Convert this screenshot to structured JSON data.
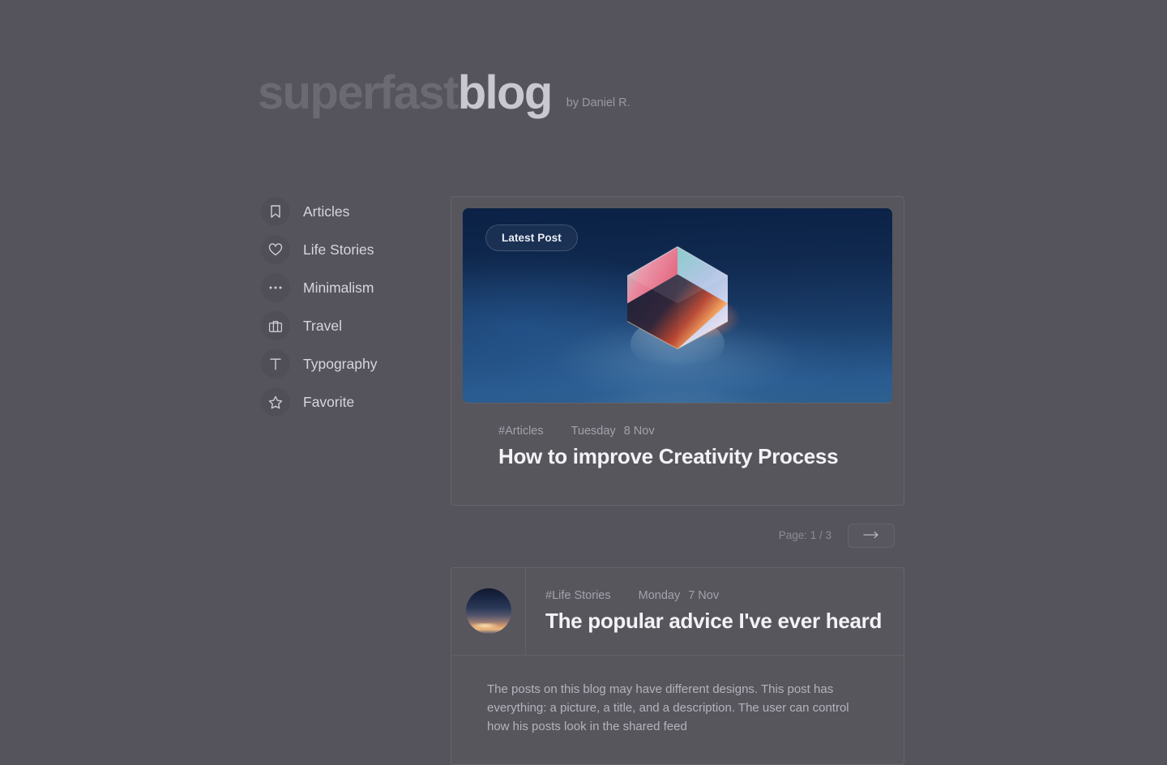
{
  "header": {
    "logo_part_a": "superfast",
    "logo_part_b": "blog",
    "byline": "by Daniel R."
  },
  "sidebar": {
    "items": [
      {
        "label": "Articles",
        "icon": "bookmark-icon"
      },
      {
        "label": "Life Stories",
        "icon": "heart-icon"
      },
      {
        "label": "Minimalism",
        "icon": "ellipsis-icon"
      },
      {
        "label": "Travel",
        "icon": "briefcase-icon"
      },
      {
        "label": "Typography",
        "icon": "text-t-icon"
      },
      {
        "label": "Favorite",
        "icon": "star-icon"
      }
    ]
  },
  "featured_post": {
    "badge": "Latest Post",
    "tag": "#Articles",
    "day": "Tuesday",
    "date": "8 Nov",
    "title": "How to improve Creativity Process",
    "image_alt": "iridescent-glass-cube"
  },
  "pagination": {
    "page_label": "Page: 1 / 3",
    "next_icon": "arrow-right-icon"
  },
  "second_post": {
    "tag": "#Life Stories",
    "day": "Monday",
    "date": "7 Nov",
    "title": "The popular advice I've ever heard",
    "thumbnail_alt": "night-sky-sunset-thumbnail",
    "description": "The posts on this blog may have different designs. This post has everything: a picture, a title, and a description. The user can control how his posts look in the shared feed"
  },
  "colors": {
    "page_background": "#55545c",
    "icon_circle": "#504f58",
    "text_primary": "#f3f3f6",
    "text_muted": "#a3a2ac",
    "hero_top": "#0b2145",
    "hero_bottom": "#2e608f"
  }
}
